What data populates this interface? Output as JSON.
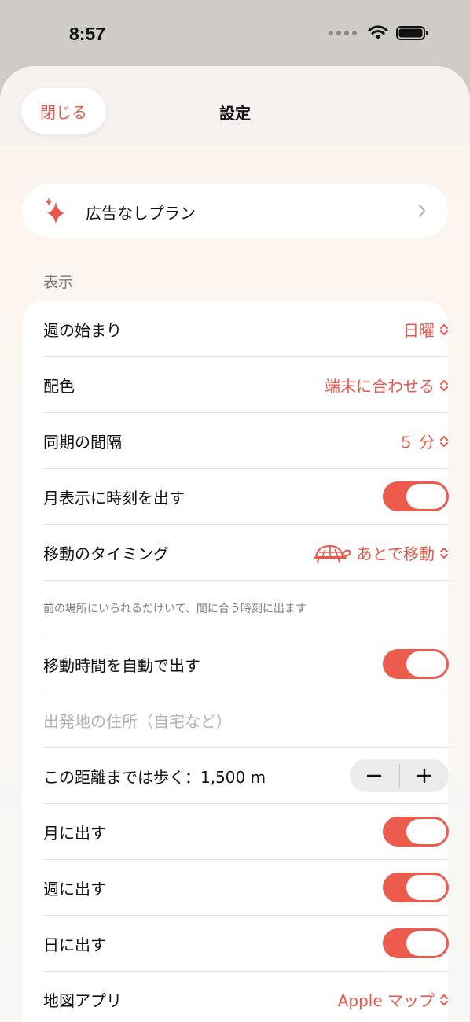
{
  "status": {
    "time": "8:57"
  },
  "nav": {
    "close_label": "閉じる",
    "title": "設定"
  },
  "plan": {
    "label": "広告なしプラン"
  },
  "display_section": {
    "header": "表示",
    "week_start": {
      "label": "週の始まり",
      "value": "日曜"
    },
    "color_scheme": {
      "label": "配色",
      "value": "端末に合わせる"
    },
    "sync_interval": {
      "label": "同期の間隔",
      "value": "５ 分"
    },
    "month_show_time": {
      "label": "月表示に時刻を出す",
      "on": true
    },
    "travel_timing": {
      "label": "移動のタイミング",
      "value": "あとで移動"
    },
    "travel_note": "前の場所にいられるだけいて、間に合う時刻に出ます",
    "auto_travel_time": {
      "label": "移動時間を自動で出す",
      "on": true
    },
    "departure_address": {
      "placeholder": "出発地の住所（自宅など）"
    },
    "walk_distance": {
      "label": "この距離までは歩く：1,500 m",
      "minus": "−",
      "plus": "+"
    },
    "show_in_month": {
      "label": "月に出す",
      "on": true
    },
    "show_in_week": {
      "label": "週に出す",
      "on": true
    },
    "show_in_day": {
      "label": "日に出す",
      "on": true
    },
    "map_app": {
      "label": "地図アプリ",
      "value": "Apple マップ"
    }
  },
  "colors": {
    "accent": "#e8574a",
    "toggle_on": "#ec5b4c",
    "background": "#cfcbc6"
  },
  "icons": [
    "wifi-icon",
    "battery-icon",
    "sparkle-icon",
    "chevron-right-icon",
    "up-down-chevron-icon",
    "turtle-icon"
  ]
}
